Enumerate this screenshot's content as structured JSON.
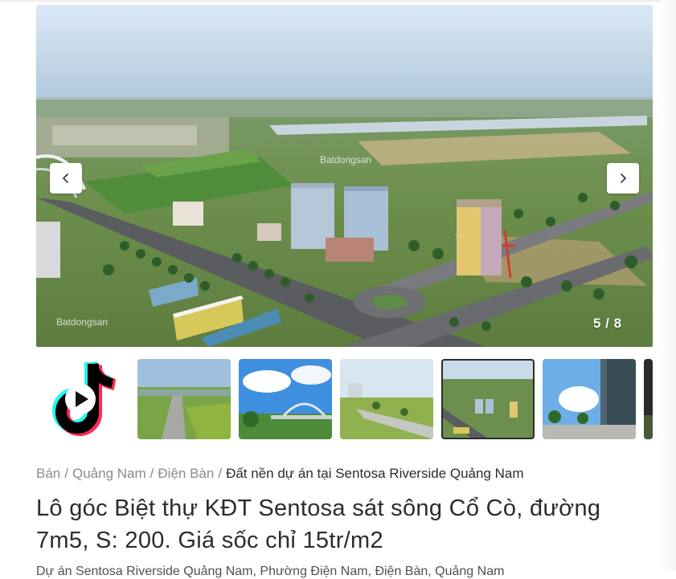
{
  "gallery": {
    "counter": "5 / 8",
    "current_index": 5,
    "total": 8,
    "watermark_top": "Batdongsan",
    "watermark_bottom": "Batdongsan",
    "prev_icon": "chevron-left-icon",
    "next_icon": "chevron-right-icon"
  },
  "thumbnails": [
    {
      "kind": "video",
      "icon": "tiktok-play-icon"
    },
    {
      "kind": "photo",
      "scene": "aerial-road-green-fields"
    },
    {
      "kind": "photo",
      "scene": "arch-bridge-blue-sky"
    },
    {
      "kind": "photo",
      "scene": "road-with-trees-town"
    },
    {
      "kind": "photo",
      "scene": "aerial-buildings",
      "active": true
    },
    {
      "kind": "photo",
      "scene": "tall-building-palm-trees"
    },
    {
      "kind": "photo",
      "scene": "partial-dark"
    }
  ],
  "breadcrumb": {
    "items": [
      "Bán",
      "Quảng Nam",
      "Điện Bàn"
    ],
    "separator": "/",
    "current": "Đất nền dự án tại Sentosa Riverside Quảng Nam"
  },
  "listing": {
    "title": "Lô góc Biệt thự KĐT Sentosa sát sông Cổ Cò, đường 7m5, S: 200. Giá sốc chỉ 15tr/m2",
    "address": "Dự án Sentosa Riverside Quảng Nam, Phường Điện Nam, Điện Bàn, Quảng Nam"
  },
  "colors": {
    "text_primary": "#2c2c2c",
    "text_muted": "#8a8a8a",
    "tiktok_cyan": "#25f4ee",
    "tiktok_red": "#fe2c55"
  }
}
